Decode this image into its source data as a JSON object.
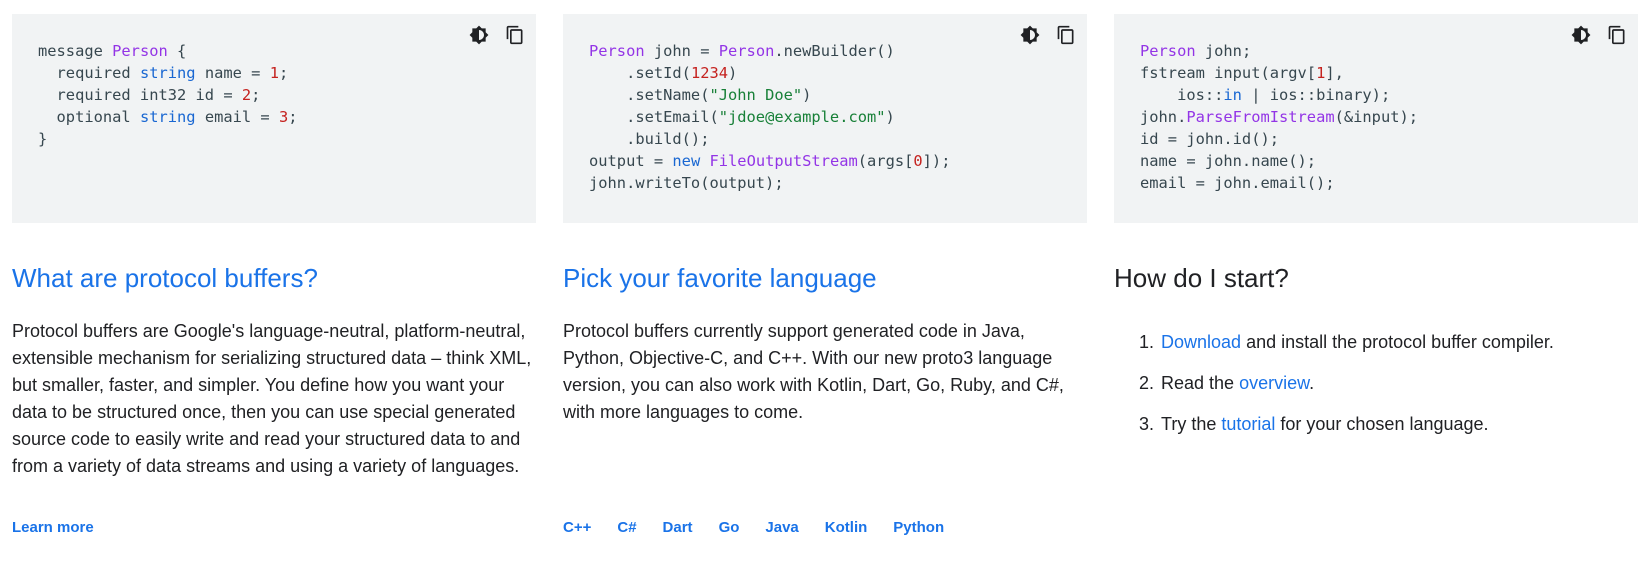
{
  "colors": {
    "link": "#1a73e8",
    "code_bg": "#f1f3f4",
    "type": "#9334e6",
    "keyword": "#1967d2",
    "number": "#c5221f",
    "string": "#188038"
  },
  "icons": [
    "theme-toggle-icon",
    "copy-icon"
  ],
  "columns": [
    {
      "code_lines": [
        [
          [
            "message ",
            ""
          ],
          [
            "Person",
            "type"
          ],
          [
            " {",
            ""
          ]
        ],
        [
          [
            "  required ",
            ""
          ],
          [
            "string",
            "keyword"
          ],
          [
            " name = ",
            ""
          ],
          [
            "1",
            "number"
          ],
          [
            ";",
            ""
          ]
        ],
        [
          [
            "  required int32 id = ",
            ""
          ],
          [
            "2",
            "number"
          ],
          [
            ";",
            ""
          ]
        ],
        [
          [
            "  optional ",
            ""
          ],
          [
            "string",
            "keyword"
          ],
          [
            " email = ",
            ""
          ],
          [
            "3",
            "number"
          ],
          [
            ";",
            ""
          ]
        ],
        [
          [
            "}",
            ""
          ]
        ]
      ],
      "heading": "What are protocol buffers?",
      "description": "Protocol buffers are Google's language-neutral, platform-neutral, extensible mechanism for serializing structured data – think XML, but smaller, faster, and simpler. You define how you want your data to be structured once, then you can use special generated source code to easily write and read your structured data to and from a variety of data streams and using a variety of languages.",
      "link": "Learn more"
    },
    {
      "code_lines": [
        [
          [
            "Person",
            "type"
          ],
          [
            " john = ",
            ""
          ],
          [
            "Person",
            "type"
          ],
          [
            ".newBuilder()",
            ""
          ]
        ],
        [
          [
            "    .setId(",
            ""
          ],
          [
            "1234",
            "number"
          ],
          [
            ")",
            ""
          ]
        ],
        [
          [
            "    .setName(",
            ""
          ],
          [
            "\"John Doe\"",
            "string"
          ],
          [
            ")",
            ""
          ]
        ],
        [
          [
            "    .setEmail(",
            ""
          ],
          [
            "\"jdoe@example.com\"",
            "string"
          ],
          [
            ")",
            ""
          ]
        ],
        [
          [
            "    .build();",
            ""
          ]
        ],
        [
          [
            "output = ",
            ""
          ],
          [
            "new",
            "keyword"
          ],
          [
            " ",
            ""
          ],
          [
            "FileOutputStream",
            "type"
          ],
          [
            "(args[",
            ""
          ],
          [
            "0",
            "number"
          ],
          [
            "]);",
            ""
          ]
        ],
        [
          [
            "john.writeTo(output);",
            ""
          ]
        ]
      ],
      "heading": "Pick your favorite language",
      "description": "Protocol buffers currently support generated code in Java, Python, Objective-C, and C++. With our new proto3 language version, you can also work with Kotlin, Dart, Go, Ruby, and C#, with more languages to come.",
      "languages": [
        "C++",
        "C#",
        "Dart",
        "Go",
        "Java",
        "Kotlin",
        "Python"
      ]
    },
    {
      "code_lines": [
        [
          [
            "Person",
            "type"
          ],
          [
            " john;",
            ""
          ]
        ],
        [
          [
            "fstream input(argv[",
            ""
          ],
          [
            "1",
            "number"
          ],
          [
            "],",
            ""
          ]
        ],
        [
          [
            "    ios::",
            ""
          ],
          [
            "in",
            "keyword"
          ],
          [
            " | ios::binary);",
            ""
          ]
        ],
        [
          [
            "john.",
            ""
          ],
          [
            "ParseFromIstream",
            "type"
          ],
          [
            "(&input);",
            ""
          ]
        ],
        [
          [
            "id = john.id();",
            ""
          ]
        ],
        [
          [
            "name = john.name();",
            ""
          ]
        ],
        [
          [
            "email = john.email();",
            ""
          ]
        ]
      ],
      "heading": "How do I start?",
      "steps": [
        {
          "link": "Download",
          "before": "",
          "after": " and install the protocol buffer compiler."
        },
        {
          "link": "overview",
          "before": "Read the ",
          "after": "."
        },
        {
          "link": "tutorial",
          "before": "Try the ",
          "after": " for your chosen language."
        }
      ]
    }
  ]
}
